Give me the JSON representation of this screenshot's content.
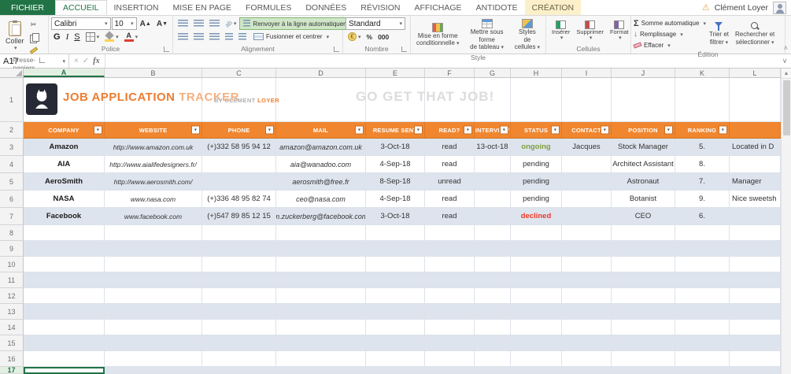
{
  "app": {
    "user_name": "Clément Loyer",
    "tabs": [
      "FICHIER",
      "ACCUEIL",
      "INSERTION",
      "MISE EN PAGE",
      "FORMULES",
      "DONNÉES",
      "RÉVISION",
      "AFFICHAGE",
      "ANTIDOTE",
      "CRÉATION"
    ]
  },
  "ribbon": {
    "clipboard": {
      "group_label": "Presse-papiers",
      "paste_label": "Coller"
    },
    "font": {
      "group_label": "Police",
      "font_name": "Calibri",
      "font_size": "10",
      "bold_label": "G",
      "italic_label": "I",
      "underline_label": "S"
    },
    "alignment": {
      "group_label": "Alignement",
      "wrap_label": "Renvoyer à la ligne automatiquement",
      "merge_label": "Fusionner et centrer"
    },
    "number": {
      "group_label": "Nombre",
      "format_value": "Standard",
      "percent_label": "%",
      "thousands_label": "000",
      "currency_label": "€"
    },
    "style": {
      "group_label": "Style",
      "conditional_l1": "Mise en forme",
      "conditional_l2": "conditionnelle",
      "format_table_l1": "Mettre sous forme",
      "format_table_l2": "de tableau",
      "cell_styles_l1": "Styles de",
      "cell_styles_l2": "cellules"
    },
    "cells": {
      "group_label": "Cellules",
      "insert_label": "Insérer",
      "delete_label": "Supprimer",
      "format_label": "Format"
    },
    "editing": {
      "group_label": "Édition",
      "autosum_label": "Somme automatique",
      "fill_label": "Remplissage",
      "clear_label": "Effacer",
      "sort_l1": "Trier et",
      "sort_l2": "filtrer",
      "find_l1": "Rechercher et",
      "find_l2": "sélectionner"
    }
  },
  "formula_bar": {
    "name_box": "A17",
    "fx_label": "fx",
    "content": ""
  },
  "sheet": {
    "column_letters": [
      "A",
      "B",
      "C",
      "D",
      "E",
      "F",
      "G",
      "H",
      "I",
      "J",
      "K",
      "L"
    ],
    "row_numbers": [
      "1",
      "2",
      "3",
      "4",
      "5",
      "6",
      "7",
      "8",
      "9",
      "10",
      "11",
      "12",
      "13",
      "14",
      "15",
      "16",
      "17"
    ],
    "selected_cell": "A17",
    "title": {
      "part1": "JOB APPLICATION",
      "part2": "TRACKER",
      "byline_prefix": "BY CLEMENT",
      "byline_name": "LOYER",
      "tagline": "GO GET THAT JOB!"
    },
    "table": {
      "headers": [
        "COMPANY",
        "WEBSITE",
        "PHONE",
        "MAIL",
        "RESUME SENT",
        "READ?",
        "INTERVIEW",
        "STATUS",
        "CONTACT",
        "POSITION",
        "RANKING",
        ""
      ],
      "field_order": [
        "company",
        "website",
        "phone",
        "mail",
        "resume_sent",
        "read",
        "interview",
        "status",
        "contact",
        "position",
        "ranking",
        "comment"
      ],
      "rows": [
        {
          "company": "Amazon",
          "website": "http://www.amazon.com.uk",
          "phone": "(+)332 58 95 94 12",
          "mail": "amazon@amazon.com.uk",
          "resume_sent": "3-Oct-18",
          "read": "read",
          "interview": "13-oct-18",
          "status": "ongoing",
          "status_color": "#7f9f3c",
          "contact": "Jacques",
          "position": "Stock Manager",
          "ranking": "5.",
          "comment": "Located in D"
        },
        {
          "company": "AIA",
          "website": "http://www.aialifedesigners.fr/",
          "phone": "",
          "mail": "aia@wanadoo.com",
          "resume_sent": "4-Sep-18",
          "read": "read",
          "interview": "",
          "status": "pending",
          "status_color": "",
          "contact": "",
          "position": "Architect Assistant",
          "ranking": "8.",
          "comment": ""
        },
        {
          "company": "AeroSmith",
          "website": "http://www.aerosmith.com/",
          "phone": "",
          "mail": "aerosmith@free.fr",
          "resume_sent": "8-Sep-18",
          "read": "unread",
          "interview": "",
          "status": "pending",
          "status_color": "",
          "contact": "",
          "position": "Astronaut",
          "ranking": "7.",
          "comment": "Manager"
        },
        {
          "company": "NASA",
          "website": "www.nasa.com",
          "phone": "(+)336 48 95 82 74",
          "mail": "ceo@nasa.com",
          "resume_sent": "4-Sep-18",
          "read": "read",
          "interview": "",
          "status": "pending",
          "status_color": "",
          "contact": "",
          "position": "Botanist",
          "ranking": "9.",
          "comment": "Nice sweetsh"
        },
        {
          "company": "Facebook",
          "website": "www.facebook.com",
          "phone": "(+)547 89 85 12 15",
          "mail": "m.zuckerberg@facebook.com",
          "resume_sent": "3-Oct-18",
          "read": "read",
          "interview": "",
          "status": "declined",
          "status_color": "#ef3826",
          "contact": "",
          "position": "CEO",
          "ranking": "6.",
          "comment": ""
        }
      ]
    },
    "colors": {
      "header_orange": "#f0862f",
      "band_blue": "#dee4ee",
      "title_orange": "#ed7d31",
      "status_ongoing": "#7f9f3c",
      "status_declined": "#ef3826",
      "excel_green": "#217346"
    }
  }
}
